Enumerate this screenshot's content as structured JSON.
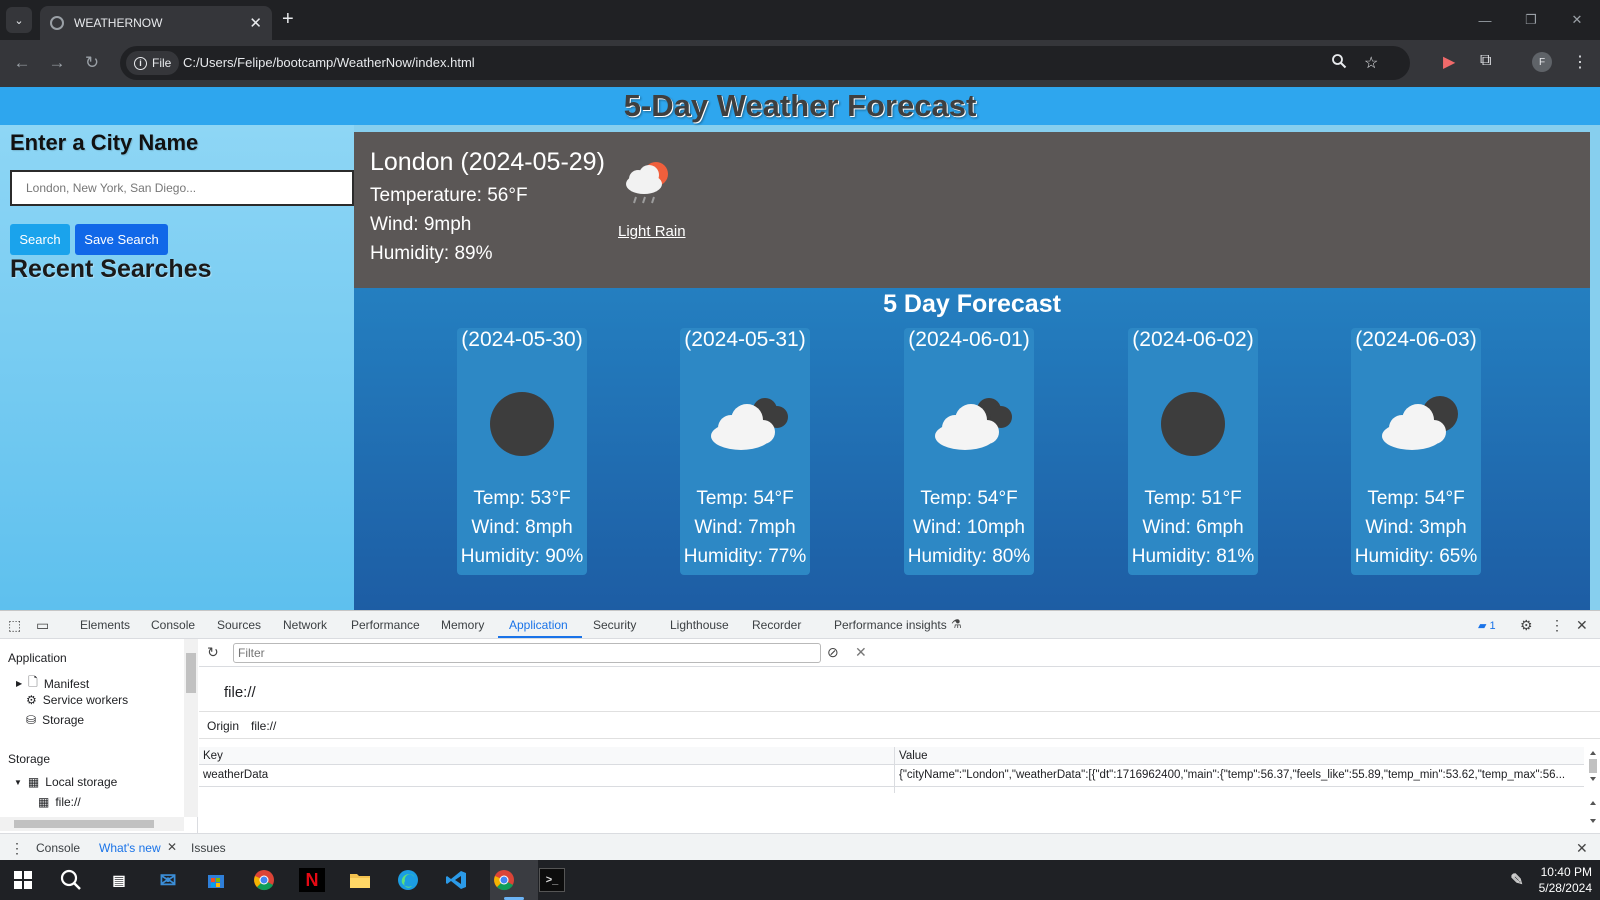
{
  "browser": {
    "tab_title": "WEATHERNOW",
    "tab_close": "✕",
    "new_tab": "+",
    "site_chip": "File",
    "url": "C:/Users/Felipe/bootcamp/WeatherNow/index.html",
    "profile_initial": "F"
  },
  "page": {
    "title": "5-Day Weather Forecast",
    "sidebar": {
      "heading": "Enter a City Name",
      "input_placeholder": "London, New York, San Diego...",
      "search_button": "Search",
      "save_button": "Save Search",
      "recent_heading": "Recent Searches"
    },
    "current": {
      "title": "London (2024-05-29)",
      "temp": "Temperature: 56°F",
      "wind": "Wind: 9mph",
      "humidity": "Humidity: 89%",
      "description": "Light Rain",
      "icon": "light-rain-icon"
    },
    "forecast": {
      "heading": "5 Day Forecast",
      "days": [
        {
          "date": "(2024-05-30)",
          "temp": "Temp: 53°F",
          "wind": "Wind: 8mph",
          "humidity": "Humidity: 90%",
          "icon": "overcast-icon"
        },
        {
          "date": "(2024-05-31)",
          "temp": "Temp: 54°F",
          "wind": "Wind: 7mph",
          "humidity": "Humidity: 77%",
          "icon": "broken-clouds-icon"
        },
        {
          "date": "(2024-06-01)",
          "temp": "Temp: 54°F",
          "wind": "Wind: 10mph",
          "humidity": "Humidity: 80%",
          "icon": "broken-clouds-icon"
        },
        {
          "date": "(2024-06-02)",
          "temp": "Temp: 51°F",
          "wind": "Wind: 6mph",
          "humidity": "Humidity: 81%",
          "icon": "overcast-icon"
        },
        {
          "date": "(2024-06-03)",
          "temp": "Temp: 54°F",
          "wind": "Wind: 3mph",
          "humidity": "Humidity: 65%",
          "icon": "scattered-clouds-icon"
        }
      ]
    }
  },
  "devtools": {
    "tabs": [
      "Elements",
      "Console",
      "Sources",
      "Network",
      "Performance",
      "Memory",
      "Application",
      "Security",
      "Lighthouse",
      "Recorder",
      "Performance insights"
    ],
    "active_tab": "Application",
    "issues_count": "1",
    "sidebar": {
      "application_heading": "Application",
      "manifest": "Manifest",
      "service_workers": "Service workers",
      "storage_item": "Storage",
      "storage_heading": "Storage",
      "local_storage": "Local storage",
      "local_storage_child": "file://"
    },
    "filter_placeholder": "Filter",
    "origin_title": "file://",
    "origin_label": "Origin",
    "origin_value": "file://",
    "grid": {
      "key_header": "Key",
      "value_header": "Value",
      "row_key": "weatherData",
      "row_value": "{\"cityName\":\"London\",\"weatherData\":[{\"dt\":1716962400,\"main\":{\"temp\":56.37,\"feels_like\":55.89,\"temp_min\":53.62,\"temp_max\":56..."
    },
    "drawer": {
      "console": "Console",
      "whats_new": "What's new",
      "issues": "Issues"
    }
  },
  "taskbar": {
    "time": "10:40 PM",
    "date": "5/28/2024"
  },
  "colors": {
    "header_bar": "#2ea6ee",
    "current_panel": "#5b5756",
    "forecast_panel": "#1d5da4",
    "save_button": "#1168e8",
    "devtools_accent": "#1a73e8"
  }
}
